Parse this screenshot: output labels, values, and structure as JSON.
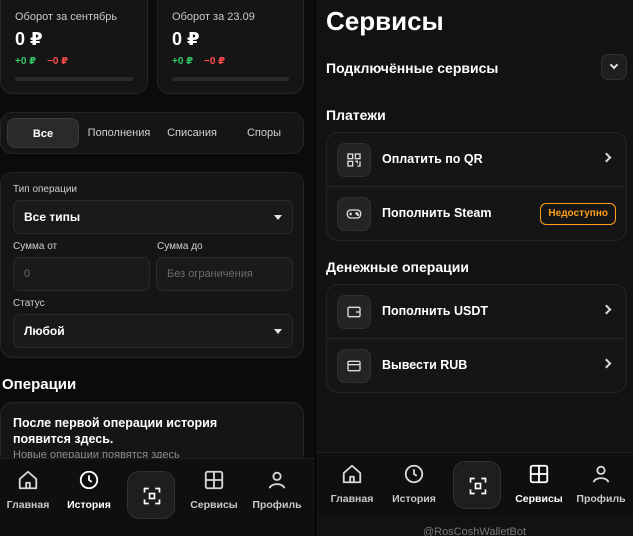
{
  "left": {
    "stats": [
      {
        "title": "Оборот за сентябрь",
        "value": "0 ₽",
        "plus": "+0 ₽",
        "minus": "−0 ₽"
      },
      {
        "title": "Оборот за 23.09",
        "value": "0 ₽",
        "plus": "+0 ₽",
        "minus": "−0 ₽"
      }
    ],
    "tabs": [
      "Все",
      "Пополнения",
      "Списания",
      "Споры"
    ],
    "filters": {
      "type_label": "Тип операции",
      "type_value": "Все типы",
      "amount_from_label": "Сумма от",
      "amount_from_placeholder": "0",
      "amount_to_label": "Сумма до",
      "amount_to_placeholder": "Без ограничения",
      "status_label": "Статус",
      "status_value": "Любой"
    },
    "operations_title": "Операции",
    "empty_title": "После первой операции история появится здесь.",
    "empty_sub": "Новые операции появятся здесь",
    "nav": [
      "Главная",
      "История",
      "Сервисы",
      "Профиль"
    ]
  },
  "right": {
    "page_title": "Сервисы",
    "connected_title": "Подключённые сервисы",
    "payments_title": "Платежи",
    "pay_qr": "Оплатить по QR",
    "steam": "Пополнить Steam",
    "steam_badge": "Недоступно",
    "money_title": "Денежные операции",
    "usdt": "Пополнить USDT",
    "rub": "Вывести RUB",
    "nav": [
      "Главная",
      "История",
      "Сервисы",
      "Профиль"
    ],
    "footer": "@RosCoshWalletBot"
  },
  "colors": {
    "positive": "#35c66b",
    "negative": "#ff4b4b",
    "warning": "#ff9f1c"
  }
}
